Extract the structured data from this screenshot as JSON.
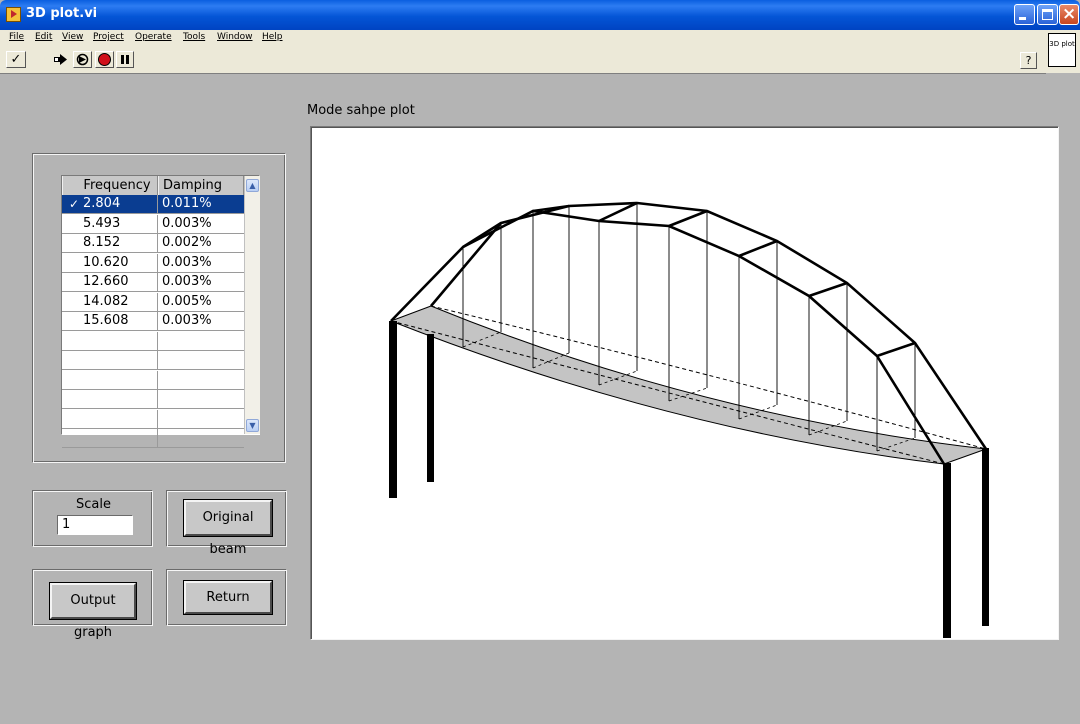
{
  "window": {
    "title": "3D plot.vi",
    "close_glyph": "×"
  },
  "menu": {
    "items": [
      "File",
      "Edit",
      "View",
      "Project",
      "Operate",
      "Tools",
      "Window",
      "Help"
    ]
  },
  "toolbar": {
    "run_check": "✓",
    "help_glyph": "?",
    "vi_icon_text": "3D plot"
  },
  "modes": {
    "columns": [
      "Frequency",
      "Damping"
    ],
    "rows": [
      {
        "frequency": "2.804",
        "damping": "0.011%",
        "selected": true
      },
      {
        "frequency": "5.493",
        "damping": "0.003%"
      },
      {
        "frequency": "8.152",
        "damping": "0.002%"
      },
      {
        "frequency": "10.620",
        "damping": "0.003%"
      },
      {
        "frequency": "12.660",
        "damping": "0.003%"
      },
      {
        "frequency": "14.082",
        "damping": "0.005%"
      },
      {
        "frequency": "15.608",
        "damping": "0.003%"
      }
    ],
    "check_mark": "✓",
    "empty_rows": 6
  },
  "scale": {
    "label": "Scale",
    "value": "1"
  },
  "buttons": {
    "original_beam": "Original beam",
    "output_graph": "Output graph",
    "return": "Return"
  },
  "plot": {
    "label": "Mode sahpe plot",
    "background": "#ffffff",
    "deck_fill": "#c4c4c4"
  }
}
